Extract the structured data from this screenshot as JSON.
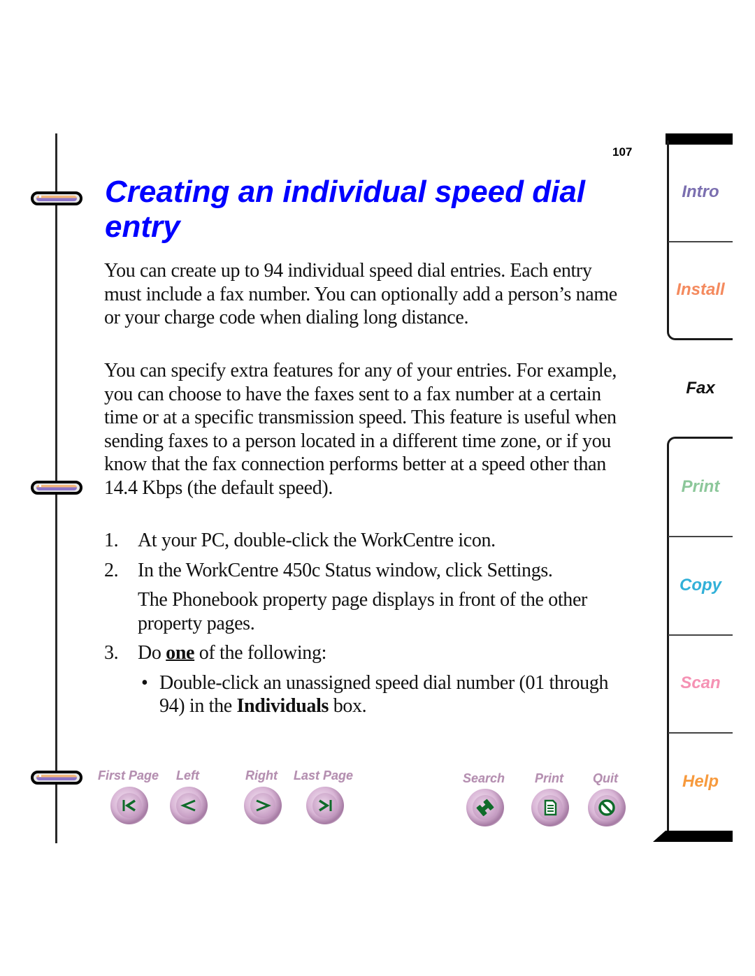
{
  "page_number": "107",
  "title": "Creating an individual speed dial entry",
  "paragraphs": [
    "You can create up to 94 individual speed dial entries. Each entry must include a fax number. You can optionally add a person’s name or your charge code when dialing long distance.",
    "You can specify extra features for any of your entries. For example, you can choose to have the faxes sent to a fax number at a certain time or at a specific transmission speed. This feature is useful when sending faxes to a person located in a different time zone, or if you know that the fax connection performs better at a speed other than 14.4 Kbps (the default speed)."
  ],
  "steps": [
    {
      "number": "1.",
      "text": "At your PC, double-click the WorkCentre icon."
    },
    {
      "number": "2.",
      "text": "In the WorkCentre 450c Status window, click Settings.",
      "note": "The Phonebook property page displays in front of the other property pages."
    },
    {
      "number": "3.",
      "text_before": "Do ",
      "emphasis": "one",
      "text_after": " of the following:"
    }
  ],
  "bullets": [
    {
      "marker": "•",
      "text_before": "Double-click an unassigned speed dial number (01 through 94) in the ",
      "bold": "Individuals",
      "text_after": " box."
    }
  ],
  "nav": {
    "first_page": {
      "label": "First Page",
      "icon": "first-page-icon"
    },
    "left": {
      "label": "Left",
      "icon": "arrow-left-icon"
    },
    "right": {
      "label": "Right",
      "icon": "arrow-right-icon"
    },
    "last_page": {
      "label": "Last Page",
      "icon": "last-page-icon"
    },
    "search": {
      "label": "Search",
      "icon": "binoculars-icon"
    },
    "print": {
      "label": "Print",
      "icon": "document-icon"
    },
    "quit": {
      "label": "Quit",
      "icon": "no-entry-icon"
    }
  },
  "tabs": [
    {
      "label": "Intro",
      "color": "#7b6fb0"
    },
    {
      "label": "Install",
      "color": "#f48a5e"
    },
    {
      "label": "Fax",
      "color": "#111111",
      "active": true
    },
    {
      "label": "Print",
      "color": "#8cc79a"
    },
    {
      "label": "Copy",
      "color": "#31b0d8"
    },
    {
      "label": "Scan",
      "color": "#f592b4"
    },
    {
      "label": "Help",
      "color": "#f79a3d"
    }
  ],
  "colors": {
    "title": "#0000ff",
    "nav_label": "#b48fb0",
    "nav_icon": "#0f6b2a"
  }
}
